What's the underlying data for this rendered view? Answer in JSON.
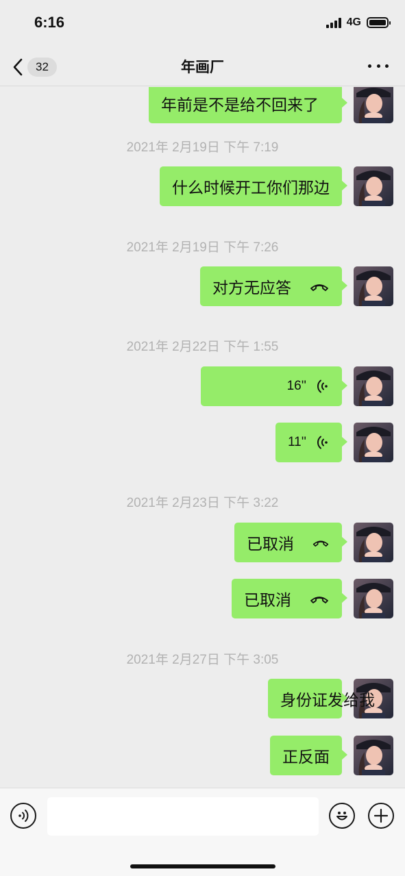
{
  "status_bar": {
    "time": "6:16",
    "network": "4G"
  },
  "header": {
    "back_count": "32",
    "title": "年画厂"
  },
  "messages": [
    {
      "type": "text",
      "text": "年前是不是给不回来了"
    },
    {
      "type": "timestamp",
      "text": "2021年 2月19日 下午 7:19"
    },
    {
      "type": "text",
      "text": "什么时候开工你们那边"
    },
    {
      "type": "timestamp",
      "text": "2021年 2月19日 下午 7:26"
    },
    {
      "type": "call",
      "text": "对方无应答"
    },
    {
      "type": "timestamp",
      "text": "2021年 2月22日 下午 1:55"
    },
    {
      "type": "voice",
      "text": "16''"
    },
    {
      "type": "voice",
      "text": "11''"
    },
    {
      "type": "timestamp",
      "text": "2021年 2月23日 下午 3:22"
    },
    {
      "type": "call",
      "text": "已取消"
    },
    {
      "type": "call",
      "text": "已取消"
    },
    {
      "type": "timestamp",
      "text": "2021年 2月27日 下午 3:05"
    },
    {
      "type": "text",
      "text": "身份证发给我"
    },
    {
      "type": "text",
      "text": "正反面"
    }
  ],
  "input": {
    "placeholder": "",
    "value": ""
  },
  "icons": {
    "back": "chevron-left-icon",
    "more": "more-icon",
    "voice_toggle": "voice-icon",
    "emoji": "emoji-icon",
    "add": "plus-icon",
    "voice_message": "voice-wave-icon",
    "call": "phone-hangup-icon"
  },
  "colors": {
    "bubble": "#95ec69",
    "background": "#ededed",
    "timestamp": "#b2b2b2"
  }
}
